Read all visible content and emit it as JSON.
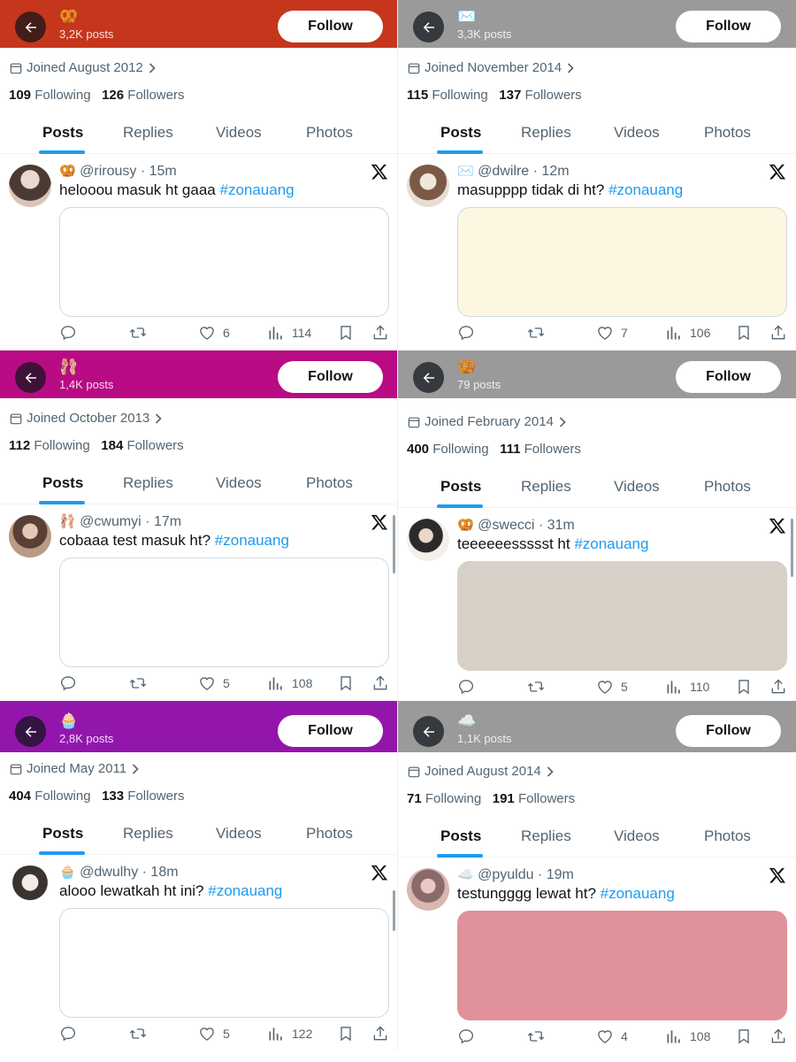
{
  "tabs": [
    "Posts",
    "Replies",
    "Videos",
    "Photos"
  ],
  "follow_label": "Follow",
  "colors": {
    "link_blue": "#1d9bf0",
    "muted_text": "#536471",
    "media_border": "#cfd9de"
  },
  "panels": [
    {
      "header_color": "#c5361d",
      "header_emoji": "🥨",
      "post_count": "3,2K posts",
      "joined": "Joined August 2012",
      "following_count": "109",
      "following_label": "Following",
      "followers_count": "126",
      "followers_label": "Followers",
      "post": {
        "emoji": "🥨",
        "handle": "@rirousy",
        "time": "· 15m",
        "text": "helooou masuk ht gaaa",
        "hashtag": "#zonauang",
        "media_color": "#ffffff",
        "likes": "6",
        "views": "114"
      }
    },
    {
      "header_color": "#9a9a9a",
      "header_emoji": "✉️",
      "post_count": "3,3K posts",
      "joined": "Joined November 2014",
      "following_count": "115",
      "following_label": "Following",
      "followers_count": "137",
      "followers_label": "Followers",
      "post": {
        "emoji": "✉️",
        "handle": "@dwilre",
        "time": "· 12m",
        "text": "masupppp tidak di ht?",
        "hashtag": "#zonauang",
        "media_color": "#fdf7e1",
        "likes": "7",
        "views": "106"
      }
    },
    {
      "header_color": "#b80b84",
      "header_emoji": "🩰",
      "post_count": "1,4K posts",
      "joined": "Joined October 2013",
      "following_count": "112",
      "following_label": "Following",
      "followers_count": "184",
      "followers_label": "Followers",
      "post": {
        "emoji": "🩰",
        "handle": "@cwumyi",
        "time": "· 17m",
        "text": "cobaaa test masuk ht?",
        "hashtag": "#zonauang",
        "media_color": "#ffffff",
        "likes": "5",
        "views": "108"
      }
    },
    {
      "header_color": "#9a9a9a",
      "header_emoji": "🥨",
      "post_count": "79 posts",
      "joined": "Joined February 2014",
      "following_count": "400",
      "following_label": "Following",
      "followers_count": "111",
      "followers_label": "Followers",
      "post": {
        "emoji": "🥨",
        "handle": "@swecci",
        "time": "· 31m",
        "text": "teeeeeessssst ht",
        "hashtag": "#zonauang",
        "media_color": "#d6d0c7",
        "likes": "5",
        "views": "110"
      }
    },
    {
      "header_color": "#9316ac",
      "header_emoji": "🧁",
      "post_count": "2,8K posts",
      "joined": "Joined May 2011",
      "following_count": "404",
      "following_label": "Following",
      "followers_count": "133",
      "followers_label": "Followers",
      "post": {
        "emoji": "🧁",
        "handle": "@dwulhy",
        "time": "· 18m",
        "text": "alooo lewatkah ht ini?",
        "hashtag": "#zonauang",
        "media_color": "#ffffff",
        "likes": "5",
        "views": "122"
      }
    },
    {
      "header_color": "#9a9a9a",
      "header_emoji": "☁️",
      "post_count": "1,1K posts",
      "joined": "Joined August 2014",
      "following_count": "71",
      "following_label": "Following",
      "followers_count": "191",
      "followers_label": "Followers",
      "post": {
        "emoji": "☁️",
        "handle": "@pyuldu",
        "time": "· 19m",
        "text": "testungggg lewat ht?",
        "hashtag": "#zonauang",
        "media_color": "#e0919a",
        "likes": "4",
        "views": "108"
      }
    }
  ]
}
